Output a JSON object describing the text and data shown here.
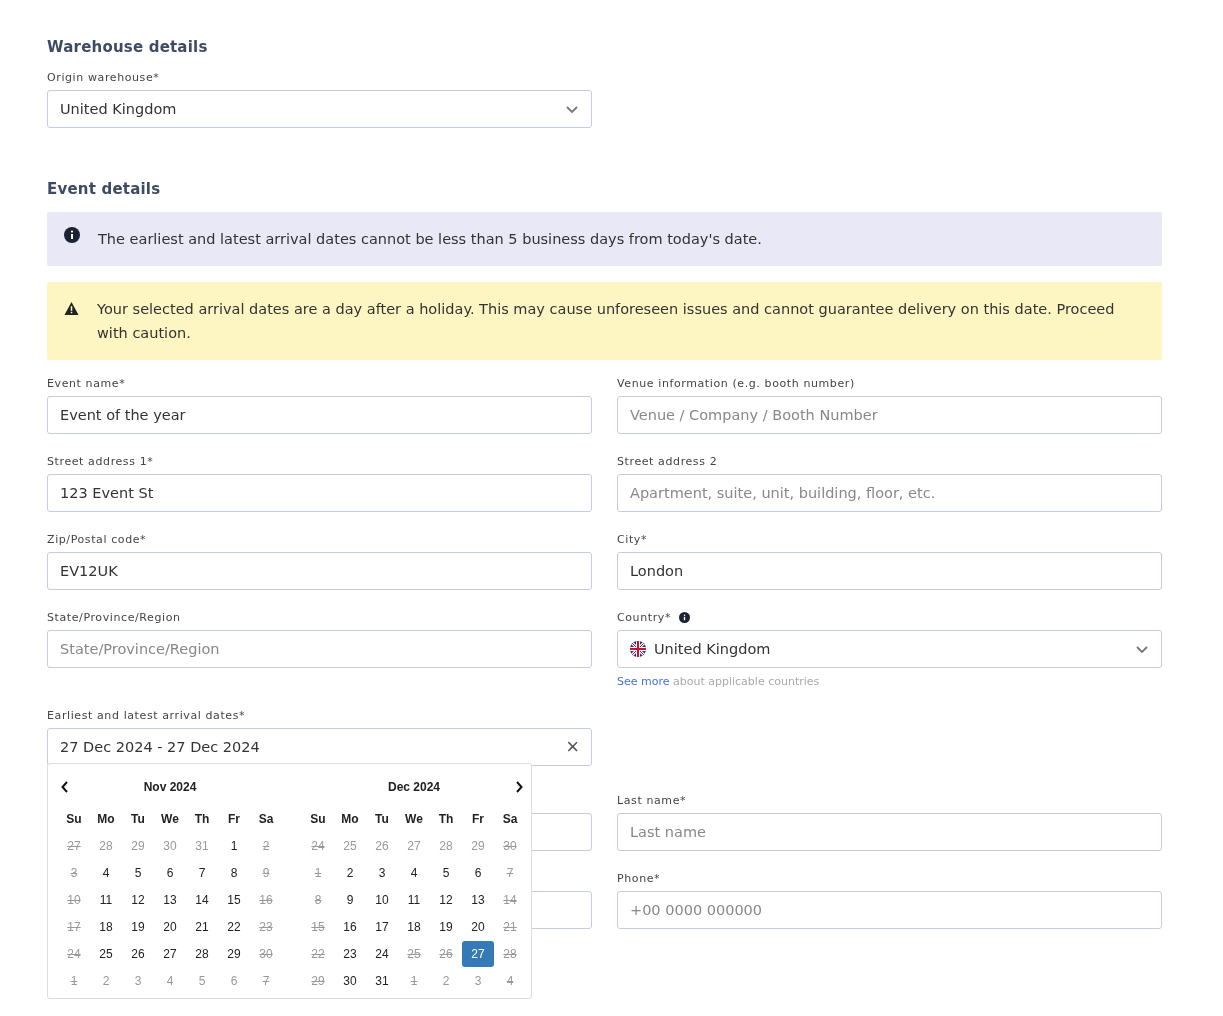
{
  "warehouse_section": {
    "title": "Warehouse details",
    "origin_warehouse": {
      "label": "Origin warehouse*",
      "value": "United Kingdom"
    }
  },
  "event_section": {
    "title": "Event details",
    "info_notice": "The earliest and latest arrival dates cannot be less than 5 business days from today's date.",
    "warning_notice": "Your selected arrival dates are a day after a holiday. This may cause unforeseen issues and cannot guarantee delivery on this date. Proceed with caution.",
    "fields": [
      {
        "kind": "text",
        "label": "Event name*",
        "value": "Event of the year"
      },
      {
        "kind": "text",
        "label": "Venue information (e.g. booth number)",
        "placeholder": "Venue / Company / Booth Number"
      },
      {
        "kind": "text",
        "label": "Street address 1*",
        "value": "123 Event St"
      },
      {
        "kind": "text",
        "label": "Street address 2",
        "placeholder": "Apartment, suite, unit, building, floor, etc."
      },
      {
        "kind": "text",
        "label": "Zip/Postal code*",
        "value": "EV12UK"
      },
      {
        "kind": "text",
        "label": "City*",
        "value": "London"
      },
      {
        "kind": "text",
        "label": "State/Province/Region",
        "placeholder": "State/Province/Region"
      },
      {
        "kind": "country",
        "label": "Country*",
        "value": "United Kingdom",
        "link": "See more",
        "note": "about applicable countries"
      }
    ],
    "arrival_dates": {
      "label": "Earliest and latest arrival dates*",
      "value": "27 Dec 2024 - 27 Dec 2024",
      "clear": "×"
    },
    "contact_fields": [
      {
        "kind": "hidden"
      },
      {
        "kind": "text",
        "label": "Last name*",
        "placeholder": "Last name"
      },
      {
        "kind": "hidden"
      },
      {
        "kind": "text",
        "label": "Phone*",
        "placeholder": "+00 0000 000000"
      }
    ]
  },
  "calendar": {
    "months": [
      {
        "title": "Nov 2024",
        "weekdays": [
          "Su",
          "Mo",
          "Tu",
          "We",
          "Th",
          "Fr",
          "Sa"
        ],
        "weeks": [
          [
            {
              "day": "27",
              "outside": true,
              "disabled": true,
              "selected": false
            },
            {
              "day": "28",
              "outside": true,
              "disabled": false,
              "selected": false
            },
            {
              "day": "29",
              "outside": true,
              "disabled": false,
              "selected": false
            },
            {
              "day": "30",
              "outside": true,
              "disabled": false,
              "selected": false
            },
            {
              "day": "31",
              "outside": true,
              "disabled": false,
              "selected": false
            },
            {
              "day": "1",
              "outside": false,
              "disabled": false,
              "selected": false
            },
            {
              "day": "2",
              "outside": false,
              "disabled": true,
              "selected": false
            }
          ],
          [
            {
              "day": "3",
              "outside": false,
              "disabled": true,
              "selected": false
            },
            {
              "day": "4",
              "outside": false,
              "disabled": false,
              "selected": false
            },
            {
              "day": "5",
              "outside": false,
              "disabled": false,
              "selected": false
            },
            {
              "day": "6",
              "outside": false,
              "disabled": false,
              "selected": false
            },
            {
              "day": "7",
              "outside": false,
              "disabled": false,
              "selected": false
            },
            {
              "day": "8",
              "outside": false,
              "disabled": false,
              "selected": false
            },
            {
              "day": "9",
              "outside": false,
              "disabled": true,
              "selected": false
            }
          ],
          [
            {
              "day": "10",
              "outside": false,
              "disabled": true,
              "selected": false
            },
            {
              "day": "11",
              "outside": false,
              "disabled": false,
              "selected": false
            },
            {
              "day": "12",
              "outside": false,
              "disabled": false,
              "selected": false
            },
            {
              "day": "13",
              "outside": false,
              "disabled": false,
              "selected": false
            },
            {
              "day": "14",
              "outside": false,
              "disabled": false,
              "selected": false
            },
            {
              "day": "15",
              "outside": false,
              "disabled": false,
              "selected": false
            },
            {
              "day": "16",
              "outside": false,
              "disabled": true,
              "selected": false
            }
          ],
          [
            {
              "day": "17",
              "outside": false,
              "disabled": true,
              "selected": false
            },
            {
              "day": "18",
              "outside": false,
              "disabled": false,
              "selected": false
            },
            {
              "day": "19",
              "outside": false,
              "disabled": false,
              "selected": false
            },
            {
              "day": "20",
              "outside": false,
              "disabled": false,
              "selected": false
            },
            {
              "day": "21",
              "outside": false,
              "disabled": false,
              "selected": false
            },
            {
              "day": "22",
              "outside": false,
              "disabled": false,
              "selected": false
            },
            {
              "day": "23",
              "outside": false,
              "disabled": true,
              "selected": false
            }
          ],
          [
            {
              "day": "24",
              "outside": false,
              "disabled": true,
              "selected": false
            },
            {
              "day": "25",
              "outside": false,
              "disabled": false,
              "selected": false
            },
            {
              "day": "26",
              "outside": false,
              "disabled": false,
              "selected": false
            },
            {
              "day": "27",
              "outside": false,
              "disabled": false,
              "selected": false
            },
            {
              "day": "28",
              "outside": false,
              "disabled": false,
              "selected": false
            },
            {
              "day": "29",
              "outside": false,
              "disabled": false,
              "selected": false
            },
            {
              "day": "30",
              "outside": false,
              "disabled": true,
              "selected": false
            }
          ],
          [
            {
              "day": "1",
              "outside": true,
              "disabled": true,
              "selected": false
            },
            {
              "day": "2",
              "outside": true,
              "disabled": false,
              "selected": false
            },
            {
              "day": "3",
              "outside": true,
              "disabled": false,
              "selected": false
            },
            {
              "day": "4",
              "outside": true,
              "disabled": false,
              "selected": false
            },
            {
              "day": "5",
              "outside": true,
              "disabled": false,
              "selected": false
            },
            {
              "day": "6",
              "outside": true,
              "disabled": false,
              "selected": false
            },
            {
              "day": "7",
              "outside": true,
              "disabled": true,
              "selected": false
            }
          ]
        ]
      },
      {
        "title": "Dec 2024",
        "weekdays": [
          "Su",
          "Mo",
          "Tu",
          "We",
          "Th",
          "Fr",
          "Sa"
        ],
        "weeks": [
          [
            {
              "day": "24",
              "outside": true,
              "disabled": true,
              "selected": false
            },
            {
              "day": "25",
              "outside": true,
              "disabled": false,
              "selected": false
            },
            {
              "day": "26",
              "outside": true,
              "disabled": false,
              "selected": false
            },
            {
              "day": "27",
              "outside": true,
              "disabled": false,
              "selected": false
            },
            {
              "day": "28",
              "outside": true,
              "disabled": false,
              "selected": false
            },
            {
              "day": "29",
              "outside": true,
              "disabled": false,
              "selected": false
            },
            {
              "day": "30",
              "outside": true,
              "disabled": true,
              "selected": false
            }
          ],
          [
            {
              "day": "1",
              "outside": false,
              "disabled": true,
              "selected": false
            },
            {
              "day": "2",
              "outside": false,
              "disabled": false,
              "selected": false
            },
            {
              "day": "3",
              "outside": false,
              "disabled": false,
              "selected": false
            },
            {
              "day": "4",
              "outside": false,
              "disabled": false,
              "selected": false
            },
            {
              "day": "5",
              "outside": false,
              "disabled": false,
              "selected": false
            },
            {
              "day": "6",
              "outside": false,
              "disabled": false,
              "selected": false
            },
            {
              "day": "7",
              "outside": false,
              "disabled": true,
              "selected": false
            }
          ],
          [
            {
              "day": "8",
              "outside": false,
              "disabled": true,
              "selected": false
            },
            {
              "day": "9",
              "outside": false,
              "disabled": false,
              "selected": false
            },
            {
              "day": "10",
              "outside": false,
              "disabled": false,
              "selected": false
            },
            {
              "day": "11",
              "outside": false,
              "disabled": false,
              "selected": false
            },
            {
              "day": "12",
              "outside": false,
              "disabled": false,
              "selected": false
            },
            {
              "day": "13",
              "outside": false,
              "disabled": false,
              "selected": false
            },
            {
              "day": "14",
              "outside": false,
              "disabled": true,
              "selected": false
            }
          ],
          [
            {
              "day": "15",
              "outside": false,
              "disabled": true,
              "selected": false
            },
            {
              "day": "16",
              "outside": false,
              "disabled": false,
              "selected": false
            },
            {
              "day": "17",
              "outside": false,
              "disabled": false,
              "selected": false
            },
            {
              "day": "18",
              "outside": false,
              "disabled": false,
              "selected": false
            },
            {
              "day": "19",
              "outside": false,
              "disabled": false,
              "selected": false
            },
            {
              "day": "20",
              "outside": false,
              "disabled": false,
              "selected": false
            },
            {
              "day": "21",
              "outside": false,
              "disabled": true,
              "selected": false
            }
          ],
          [
            {
              "day": "22",
              "outside": false,
              "disabled": true,
              "selected": false
            },
            {
              "day": "23",
              "outside": false,
              "disabled": false,
              "selected": false
            },
            {
              "day": "24",
              "outside": false,
              "disabled": false,
              "selected": false
            },
            {
              "day": "25",
              "outside": false,
              "disabled": true,
              "selected": false
            },
            {
              "day": "26",
              "outside": false,
              "disabled": true,
              "selected": false
            },
            {
              "day": "27",
              "outside": false,
              "disabled": false,
              "selected": true
            },
            {
              "day": "28",
              "outside": false,
              "disabled": true,
              "selected": false
            }
          ],
          [
            {
              "day": "29",
              "outside": false,
              "disabled": true,
              "selected": false
            },
            {
              "day": "30",
              "outside": false,
              "disabled": false,
              "selected": false
            },
            {
              "day": "31",
              "outside": false,
              "disabled": false,
              "selected": false
            },
            {
              "day": "1",
              "outside": true,
              "disabled": true,
              "selected": false
            },
            {
              "day": "2",
              "outside": true,
              "disabled": false,
              "selected": false
            },
            {
              "day": "3",
              "outside": true,
              "disabled": false,
              "selected": false
            },
            {
              "day": "4",
              "outside": true,
              "disabled": true,
              "selected": false
            }
          ]
        ]
      }
    ]
  }
}
